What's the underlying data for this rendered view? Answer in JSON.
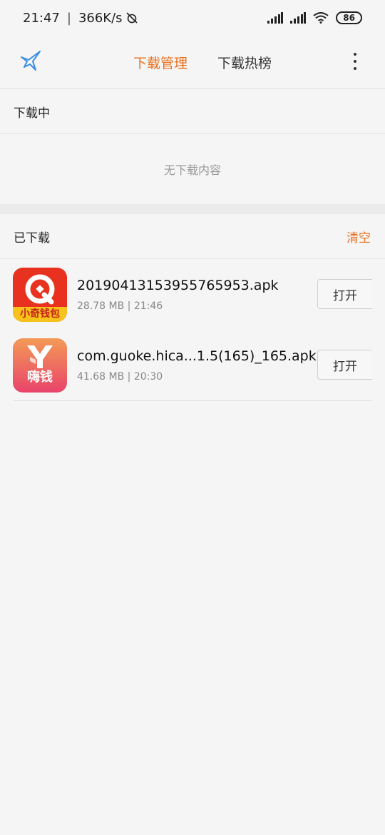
{
  "status": {
    "time": "21:47",
    "speed": "366K/s",
    "battery": "86"
  },
  "header": {
    "tabs": [
      {
        "label": "下载管理",
        "active": true
      },
      {
        "label": "下载热榜",
        "active": false
      }
    ]
  },
  "downloading": {
    "title": "下载中",
    "empty_text": "无下载内容"
  },
  "downloaded": {
    "title": "已下载",
    "clear_label": "清空",
    "items": [
      {
        "icon_name": "xiaoqi-wallet-app-icon",
        "icon_label": "小奇钱包",
        "filename": "20190413153955765953.apk",
        "size": "28.78 MB",
        "time": "21:46",
        "open_label": "打开"
      },
      {
        "icon_name": "haiqian-app-icon",
        "icon_label": "嗨钱",
        "filename": "com.guoke.hica...1.5(165)_165.apk",
        "size": "41.68 MB",
        "time": "20:30",
        "open_label": "打开"
      }
    ]
  },
  "colors": {
    "accent": "#e8711f",
    "xiaoqi_red": "#e8311f",
    "xiaoqi_yellow": "#f8c21c",
    "haiqian_gradient_top": "#f39a56",
    "haiqian_gradient_bottom": "#e9436a"
  }
}
